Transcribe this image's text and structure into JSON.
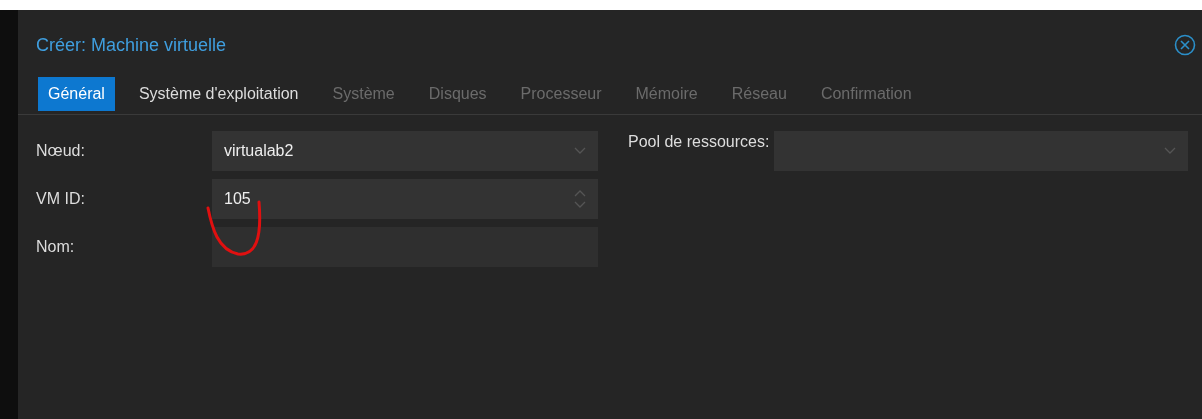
{
  "window": {
    "title": "Créer: Machine virtuelle"
  },
  "tabs": [
    {
      "label": "Général",
      "selected": true,
      "disabled": false
    },
    {
      "label": "Système d'exploitation",
      "selected": false,
      "disabled": false
    },
    {
      "label": "Système",
      "selected": false,
      "disabled": true
    },
    {
      "label": "Disques",
      "selected": false,
      "disabled": true
    },
    {
      "label": "Processeur",
      "selected": false,
      "disabled": true
    },
    {
      "label": "Mémoire",
      "selected": false,
      "disabled": true
    },
    {
      "label": "Réseau",
      "selected": false,
      "disabled": true
    },
    {
      "label": "Confirmation",
      "selected": false,
      "disabled": true
    }
  ],
  "left_fields": [
    {
      "label": "Nœud:",
      "kind": "select",
      "value": "virtualab2"
    },
    {
      "label": "VM ID:",
      "kind": "spinner",
      "value": "105"
    },
    {
      "label": "Nom:",
      "kind": "text"
    }
  ],
  "right_fields": [
    {
      "label": "Pool de ressources:",
      "kind": "select"
    }
  ]
}
